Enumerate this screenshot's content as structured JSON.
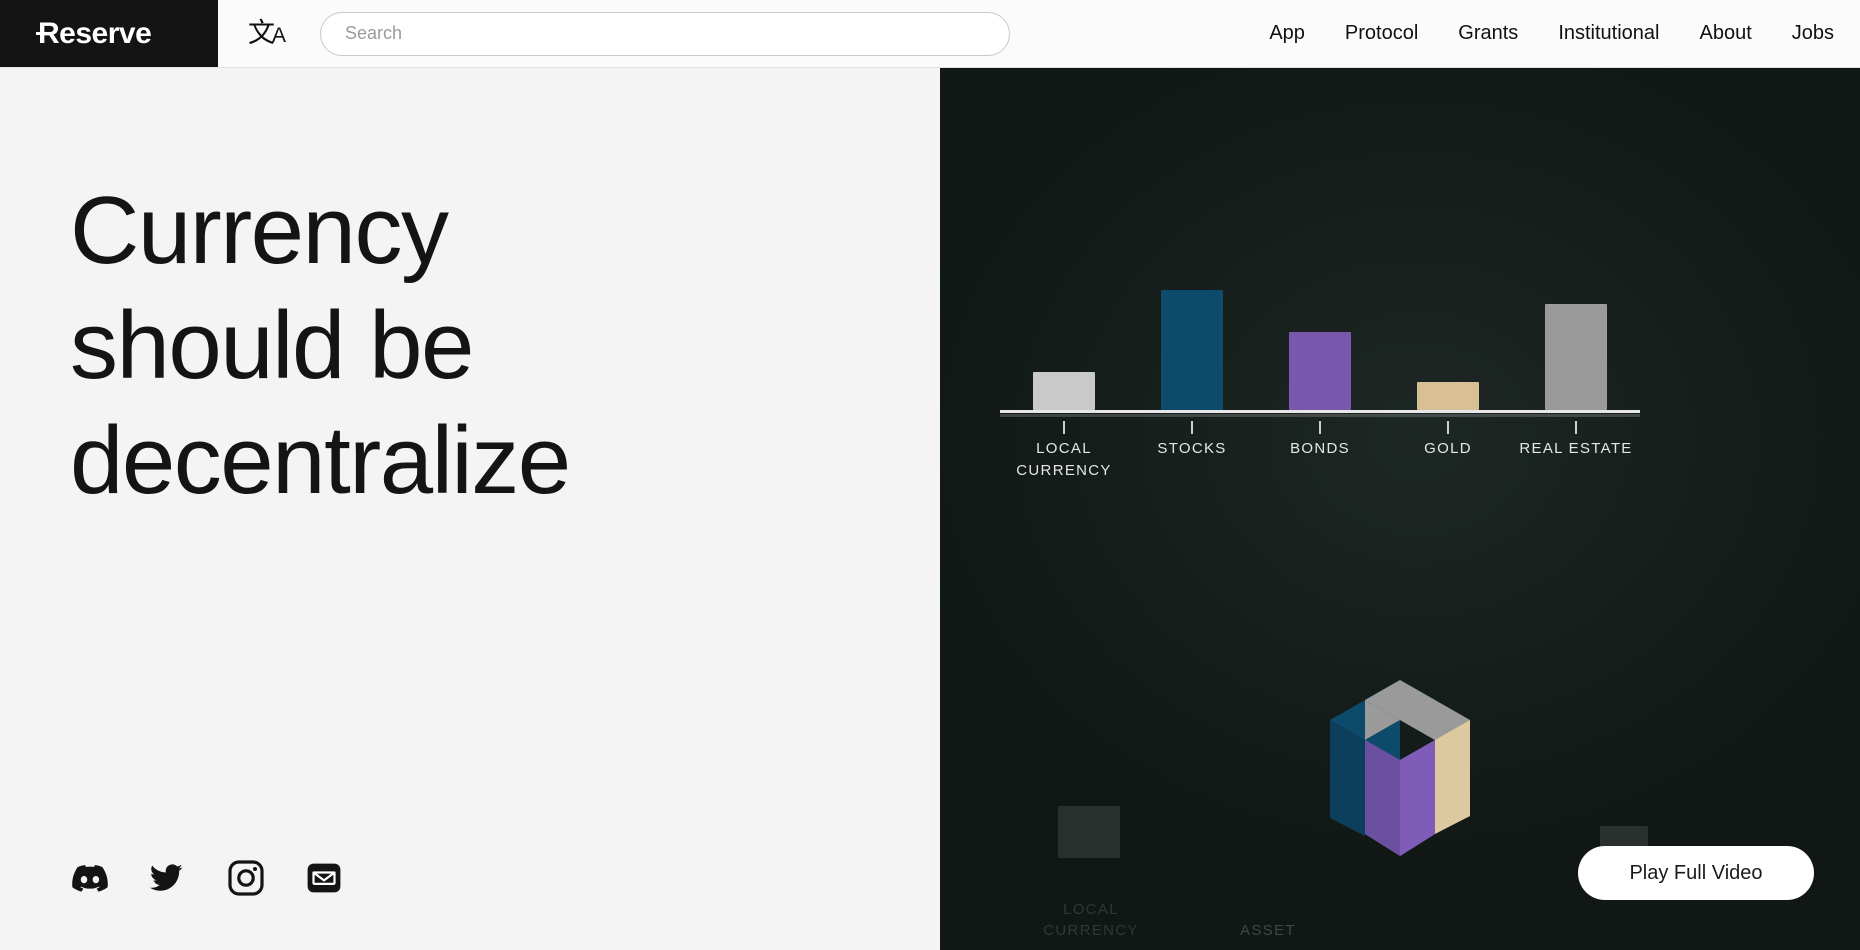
{
  "header": {
    "logo_text": "Reserve",
    "lang_icon_cjk": "文",
    "lang_icon_latin": "A",
    "search": {
      "placeholder": "Search",
      "value": ""
    },
    "nav": [
      {
        "label": "App"
      },
      {
        "label": "Protocol"
      },
      {
        "label": "Grants"
      },
      {
        "label": "Institutional"
      },
      {
        "label": "About"
      },
      {
        "label": "Jobs"
      }
    ]
  },
  "hero": {
    "headline_line1": "Currency",
    "headline_line2": "should be",
    "headline_line3": "decentralize",
    "socials": [
      {
        "name": "discord-icon"
      },
      {
        "name": "twitter-icon"
      },
      {
        "name": "instagram-icon"
      },
      {
        "name": "email-icon"
      }
    ]
  },
  "panel": {
    "play_button_label": "Play Full Video",
    "ghost_label_1": "LOCAL CURRENCY",
    "ghost_label_2": "ASSET",
    "cube_colors": {
      "top_gray": "#9a9a9a",
      "top_blue": "#0d4a6b",
      "right_tan": "#e3cfa4",
      "front_purple": "#7857ad",
      "left_blue": "#0d4a6b",
      "front_dark": "#5f4490"
    }
  },
  "chart_data": {
    "type": "bar",
    "title": "",
    "xlabel": "",
    "ylabel": "",
    "grid": false,
    "legend": false,
    "categories": [
      "LOCAL CURRENCY",
      "STOCKS",
      "BONDS",
      "GOLD",
      "REAL ESTATE"
    ],
    "values": [
      32,
      100,
      65,
      23,
      88
    ],
    "ylim": [
      0,
      110
    ],
    "colors": [
      "#c9c9c9",
      "#0d4a6b",
      "#7857ad",
      "#d9c094",
      "#9a9a9a"
    ]
  },
  "colors": {
    "page_bg": "#f4f4f4",
    "header_bg": "#fbfbfb",
    "logo_bg": "#141414",
    "panel_bg": "#101715",
    "text_dark": "#141414",
    "accent_white": "#ffffff"
  }
}
